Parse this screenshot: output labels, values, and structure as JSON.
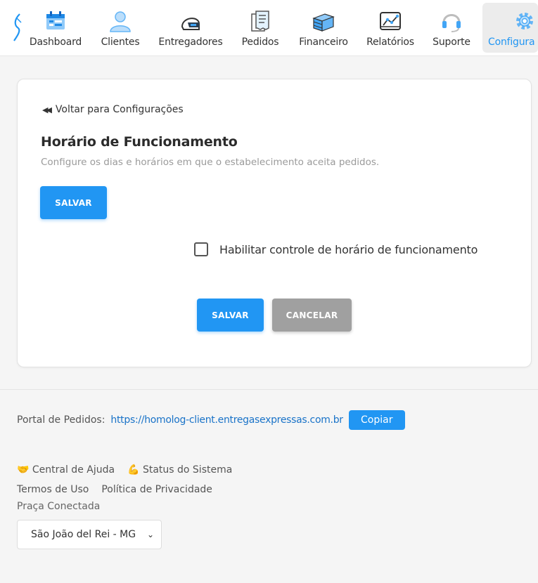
{
  "nav": {
    "items": [
      {
        "label": "Dashboard",
        "icon": "dashboard-icon"
      },
      {
        "label": "Clientes",
        "icon": "user-icon"
      },
      {
        "label": "Entregadores",
        "icon": "helmet-icon"
      },
      {
        "label": "Pedidos",
        "icon": "receipt-icon"
      },
      {
        "label": "Financeiro",
        "icon": "money-stack-icon"
      },
      {
        "label": "Relatórios",
        "icon": "chart-icon"
      },
      {
        "label": "Suporte",
        "icon": "headset-icon"
      },
      {
        "label": "Configura",
        "icon": "gear-icon",
        "active": true
      }
    ],
    "accent": "#2196f3"
  },
  "card": {
    "back_label": "Voltar para Configurações",
    "title": "Horário de Funcionamento",
    "subtitle": "Configure os dias e horários em que o estabelecimento aceita pedidos.",
    "save_label": "SALVAR",
    "checkbox_label": "Habilitar controle de horário de funcionamento",
    "checkbox_checked": false,
    "save_bottom_label": "SALVAR",
    "cancel_label": "CANCELAR"
  },
  "footer": {
    "portal_label": "Portal de Pedidos:",
    "portal_url": "https://homolog-client.entregasexpressas.com.br",
    "copy_label": "Copiar",
    "help_label": "🤝 Central de Ajuda",
    "status_label": "💪 Status do Sistema",
    "terms_label": "Termos de Uso",
    "privacy_label": "Política de Privacidade",
    "praca_label": "Praça Conectada",
    "praca_value": "São João del Rei - MG"
  }
}
